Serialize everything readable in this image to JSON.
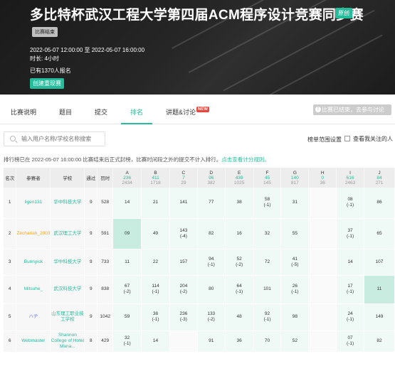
{
  "contest": {
    "title": "多比特杯武汉工程大学第四届ACM程序设计竞赛同步赛",
    "original_badge": "原创",
    "rated_tag": "比赛结束",
    "time_range": "2022-05-07 12:00:00 至 2022-05-07 16:00:00",
    "duration": "时长: 4小时",
    "registered": "已有1370人报名",
    "create_button": "创建重现赛"
  },
  "tabs": [
    {
      "label": "比赛说明"
    },
    {
      "label": "题目"
    },
    {
      "label": "提交"
    },
    {
      "label": "排名"
    },
    {
      "label": "讲题&讨论"
    }
  ],
  "new_badge": "NEW",
  "ended_button": "比赛已结束，去参与讨论",
  "search": {
    "placeholder": "输入用户名称/学校名称搜索"
  },
  "range_setting": "榜单范围设置",
  "follow_label": "查看我关注的人",
  "notice": {
    "text": "排行榜已在 2022-05-07 16:00:00 比赛结束后正式封榜，比赛时间段之外的提交不计入排行。",
    "link": "点击查看计分规则。"
  },
  "table": {
    "headers": {
      "rank": "名次",
      "user": "参赛者",
      "school": "学校",
      "solved": "通过",
      "penalty": "罚时"
    },
    "problems": [
      {
        "letter": "A",
        "ac": "236",
        "tries": "2434"
      },
      {
        "letter": "B",
        "ac": "411",
        "tries": "1718"
      },
      {
        "letter": "C",
        "ac": "7",
        "tries": "29"
      },
      {
        "letter": "D",
        "ac": "96",
        "tries": "382"
      },
      {
        "letter": "E",
        "ac": "439",
        "tries": "1025"
      },
      {
        "letter": "F",
        "ac": "45",
        "tries": "145"
      },
      {
        "letter": "G",
        "ac": "140",
        "tries": "817"
      },
      {
        "letter": "H",
        "ac": "0",
        "tries": "36"
      },
      {
        "letter": "I",
        "ac": "616",
        "tries": "2463"
      },
      {
        "letter": "J",
        "ac": "84",
        "tries": "271"
      }
    ],
    "rows": [
      {
        "rank": "1",
        "user": "ligen131",
        "user_color": "green",
        "school": "华中科技大学",
        "solved": "9",
        "penalty": "528",
        "cells": [
          [
            "14",
            ""
          ],
          [
            "21",
            ""
          ],
          [
            "141",
            ""
          ],
          [
            "77",
            ""
          ],
          [
            "38",
            ""
          ],
          [
            "58",
            "(-1)"
          ],
          [
            "31",
            ""
          ],
          [
            "",
            ""
          ],
          [
            "08",
            "(-1)"
          ],
          [
            "86",
            ""
          ]
        ]
      },
      {
        "rank": "2",
        "user": "Zechariah_2003",
        "user_color": "orange",
        "school": "武汉理工大学",
        "solved": "9",
        "penalty": "591",
        "cells": [
          [
            "09",
            ""
          ],
          [
            "49",
            ""
          ],
          [
            "143",
            "(-4)"
          ],
          [
            "82",
            ""
          ],
          [
            "16",
            ""
          ],
          [
            "32",
            ""
          ],
          [
            "55",
            ""
          ],
          [
            "",
            ""
          ],
          [
            "37",
            "(-1)"
          ],
          [
            "65",
            ""
          ]
        ]
      },
      {
        "rank": "3",
        "user": "Bunnyick",
        "user_color": "green",
        "school": "华中科技大学",
        "solved": "9",
        "penalty": "733",
        "cells": [
          [
            "11",
            ""
          ],
          [
            "22",
            ""
          ],
          [
            "157",
            ""
          ],
          [
            "94",
            "(-1)"
          ],
          [
            "52",
            "(-2)"
          ],
          [
            "72",
            ""
          ],
          [
            "41",
            "(-5)"
          ],
          [
            "",
            ""
          ],
          [
            "14",
            ""
          ],
          [
            "107",
            ""
          ]
        ]
      },
      {
        "rank": "4",
        "user": "Mitsuhe_",
        "user_color": "green",
        "school": "武汉科技大学",
        "solved": "9",
        "penalty": "838",
        "cells": [
          [
            "67",
            "(-2)"
          ],
          [
            "114",
            "(-1)"
          ],
          [
            "204",
            "(-2)"
          ],
          [
            "80",
            ""
          ],
          [
            "64",
            "(-1)"
          ],
          [
            "101",
            ""
          ],
          [
            "26",
            "(-1)"
          ],
          [
            "",
            ""
          ],
          [
            "17",
            "(-1)"
          ],
          [
            "11",
            ""
          ]
        ]
      },
      {
        "rank": "5",
        "user": "ハヂ",
        "user_color": "blue",
        "school": "山东理工职业技工学校",
        "solved": "9",
        "penalty": "1042",
        "cells": [
          [
            "59",
            ""
          ],
          [
            "38",
            "(-1)"
          ],
          [
            "236",
            "(-3)"
          ],
          [
            "133",
            "(-2)"
          ],
          [
            "48",
            ""
          ],
          [
            "92",
            "(-1)"
          ],
          [
            "98",
            ""
          ],
          [
            "",
            ""
          ],
          [
            "24",
            "(-1)"
          ],
          [
            "149",
            ""
          ]
        ]
      },
      {
        "rank": "6",
        "user": "Webmaster",
        "user_color": "green",
        "school": "Shannon College of Hotel Mana...",
        "solved": "8",
        "penalty": "429",
        "cells": [
          [
            "32",
            "(-1)"
          ],
          [
            "14",
            ""
          ],
          [
            "",
            ""
          ],
          [
            "91",
            ""
          ],
          [
            "36",
            ""
          ],
          [
            "70",
            ""
          ],
          [
            "52",
            ""
          ],
          [
            "",
            ""
          ],
          [
            "07",
            "(-1)"
          ],
          [
            "82",
            ""
          ]
        ]
      }
    ]
  },
  "colors": {
    "accent": "#25bb9b",
    "new_badge": "#e8453c",
    "first_blood": "#c9ece1",
    "solved": "#eff9f6"
  }
}
